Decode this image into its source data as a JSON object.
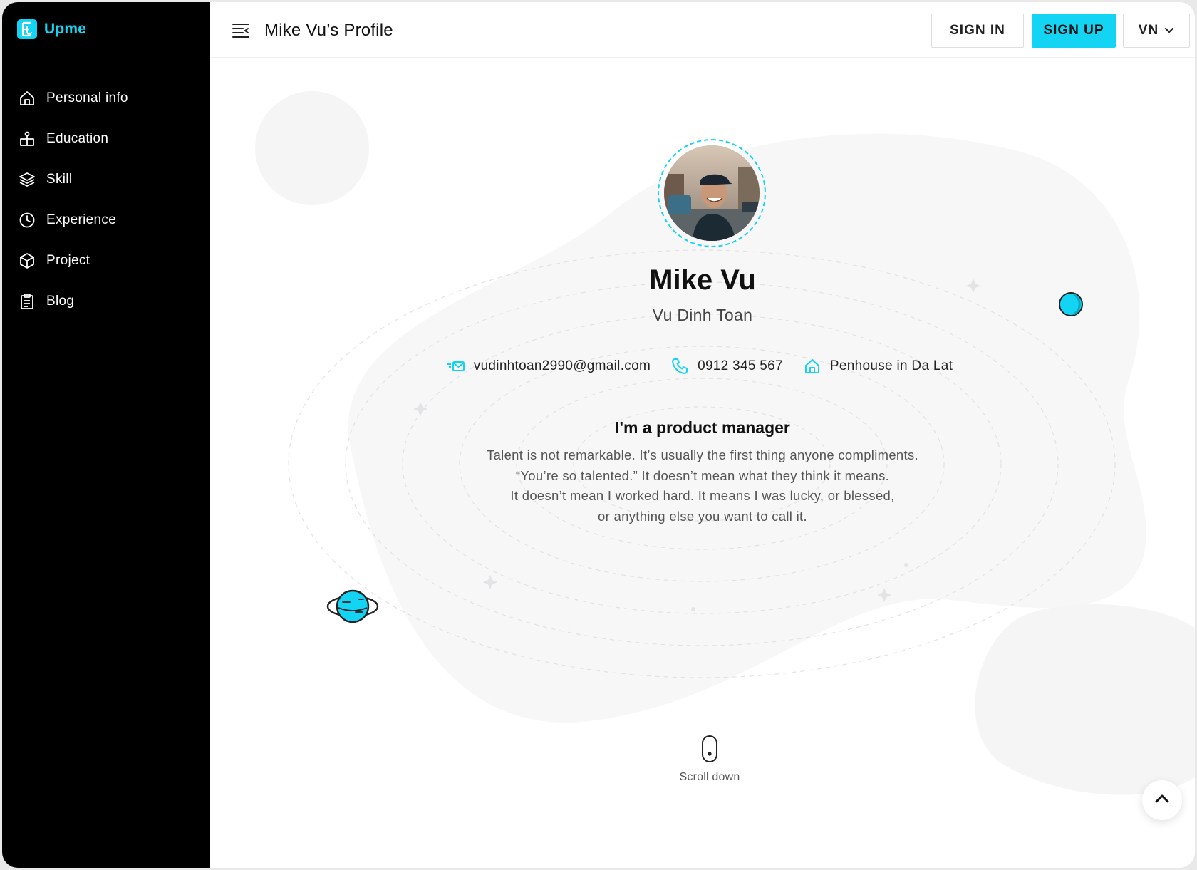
{
  "app": {
    "name": "Upme",
    "page_title": "Mike Vu’s Profile"
  },
  "sidebar": {
    "items": [
      {
        "label": "Personal info",
        "icon": "home-icon"
      },
      {
        "label": "Education",
        "icon": "education-icon"
      },
      {
        "label": "Skill",
        "icon": "layers-icon"
      },
      {
        "label": "Experience",
        "icon": "clock-icon"
      },
      {
        "label": "Project",
        "icon": "cube-icon"
      },
      {
        "label": "Blog",
        "icon": "clipboard-icon"
      }
    ]
  },
  "header": {
    "sign_in": "SIGN IN",
    "sign_up": "SIGN UP",
    "language": "VN"
  },
  "profile": {
    "name": "Mike Vu",
    "full_name": "Vu Dinh Toan",
    "email": "vudinhtoan2990@gmail.com",
    "phone": "0912 345 567",
    "address": "Penhouse in Da Lat",
    "headline": "I'm a product manager",
    "bio": [
      "Talent is not remarkable. It’s usually the first thing anyone compliments.",
      "“You’re so talented.” It doesn’t mean what they think it means.",
      "It doesn’t mean I worked hard. It means I was lucky, or blessed,",
      "or anything else you want to call it."
    ]
  },
  "scroll": {
    "label": "Scroll down"
  },
  "colors": {
    "accent": "#13d4f3",
    "sidebar_bg": "#000000",
    "text": "#111111"
  }
}
